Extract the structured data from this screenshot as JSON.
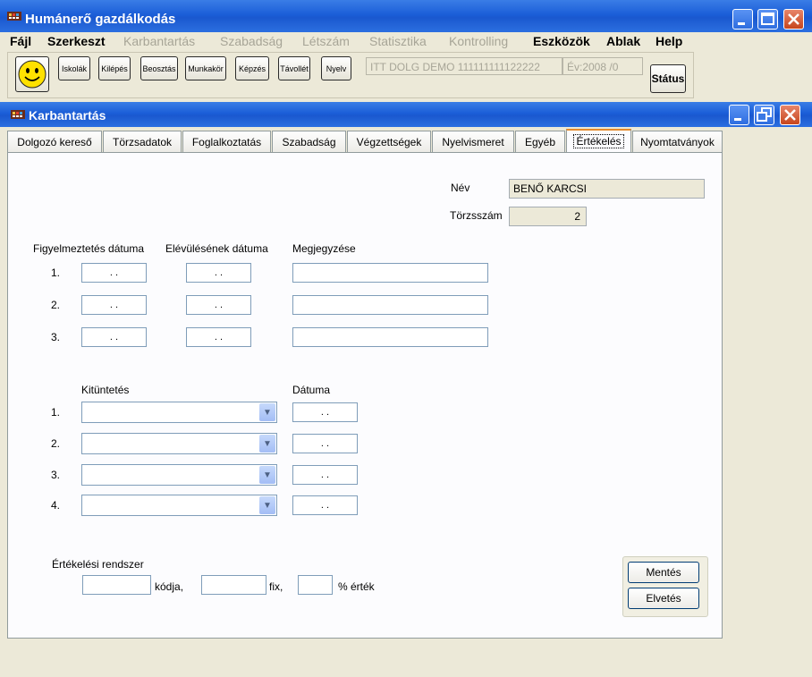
{
  "app": {
    "title": "Humánerő gazdálkodás",
    "menu": [
      {
        "label": "Fájl",
        "enabled": true
      },
      {
        "label": "Szerkeszt",
        "enabled": true
      },
      {
        "label": "Karbantartás",
        "enabled": false
      },
      {
        "label": "Szabadság",
        "enabled": false
      },
      {
        "label": "Létszám",
        "enabled": false
      },
      {
        "label": "Statisztika",
        "enabled": false
      },
      {
        "label": "Kontrolling",
        "enabled": false
      },
      {
        "label": "Eszközök",
        "enabled": true
      },
      {
        "label": "Ablak",
        "enabled": true
      },
      {
        "label": "Help",
        "enabled": true
      }
    ],
    "toolbar": {
      "buttons": [
        "Iskolák",
        "Kilépés",
        "Beosztás",
        "Munkakör",
        "Képzés",
        "Távollét",
        "Nyelv"
      ],
      "db_info": "ITT DOLG DEMO 111111111122222",
      "year_info": "Év:2008  /0",
      "status_label": "Státus"
    }
  },
  "child_window": {
    "title": "Karbantartás",
    "tabs": [
      "Dolgozó kereső",
      "Törzsadatok",
      "Foglalkoztatás",
      "Szabadság",
      "Végzettségek",
      "Nyelvismeret",
      "Egyéb",
      "Értékelés",
      "Nyomtatványok"
    ],
    "active_tab": "Értékelés"
  },
  "employee": {
    "name_label": "Név",
    "name_value": "BENŐ KARCSI",
    "id_label": "Törzsszám",
    "id_value": "2"
  },
  "warnings": {
    "headers": {
      "date": "Figyelmeztetés dátuma",
      "expiry": "Elévülésének dátuma",
      "note": "Megjegyzése"
    },
    "rows": [
      {
        "num": "1.",
        "date": " .  .",
        "expiry": " .  .",
        "note": ""
      },
      {
        "num": "2.",
        "date": " .  .",
        "expiry": " .  .",
        "note": ""
      },
      {
        "num": "3.",
        "date": " .  .",
        "expiry": " .  .",
        "note": ""
      }
    ]
  },
  "awards": {
    "headers": {
      "award": "Kitüntetés",
      "date": "Dátuma"
    },
    "rows": [
      {
        "num": "1.",
        "award": "",
        "date": " .  ."
      },
      {
        "num": "2.",
        "award": "",
        "date": " .  ."
      },
      {
        "num": "3.",
        "award": "",
        "date": " .  ."
      },
      {
        "num": "4.",
        "award": "",
        "date": " .  ."
      }
    ]
  },
  "rating_system": {
    "label": "Értékelési rendszer",
    "code_suffix": "kódja,",
    "fix_suffix": "fix,",
    "percent_suffix": "% érték",
    "code_value": "",
    "fix_value": "",
    "percent_value": ""
  },
  "actions": {
    "save": "Mentés",
    "discard": "Elvetés"
  }
}
